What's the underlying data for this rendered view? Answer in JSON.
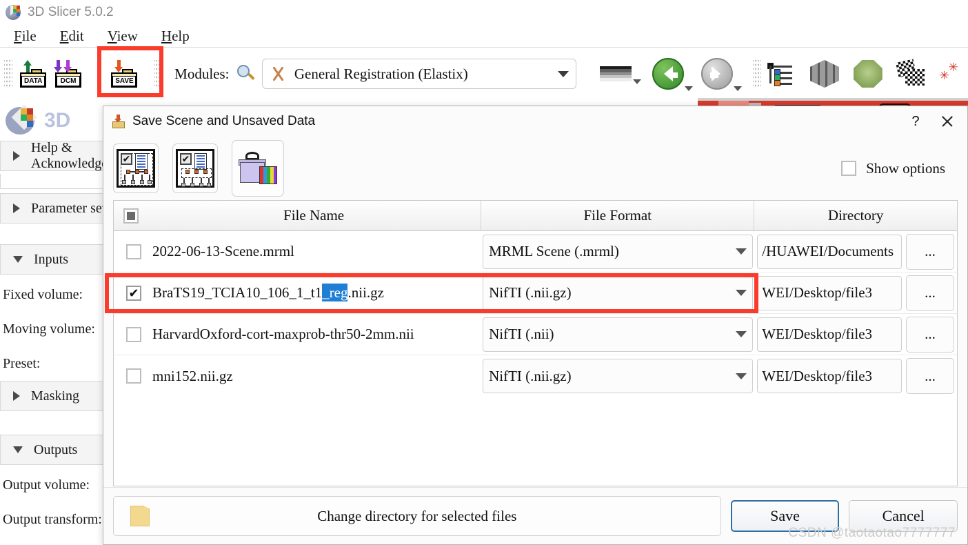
{
  "app": {
    "title": "3D Slicer 5.0.2",
    "logo_icon": "slicer-logo-icon",
    "menus": [
      {
        "label": "File",
        "mnemonic": "F"
      },
      {
        "label": "Edit",
        "mnemonic": "E"
      },
      {
        "label": "View",
        "mnemonic": "V"
      },
      {
        "label": "Help",
        "mnemonic": "H"
      }
    ]
  },
  "toolbar": {
    "data_button_label": "DATA",
    "dcm_button_label": "DCM",
    "save_button_label": "SAVE",
    "modules_label": "Modules:",
    "search_icon": "magnifier-icon",
    "module_selected": "General Registration (Elastix)",
    "module_icon": "elastix-scissors-icon",
    "icons": [
      "grayscale-colormap-icon",
      "previous-module-icon",
      "next-module-icon",
      "subject-hierarchy-icon",
      "volume-rendering-icon",
      "models-icon",
      "grid-transform-icon",
      "markups-icon"
    ],
    "save_button_highlighted": true
  },
  "left_panel": {
    "brand": "3D",
    "logo_icon": "slicer-panel-logo-icon",
    "sections": [
      {
        "label": "Help & Acknowledgement",
        "state": "collapsed"
      },
      {
        "label": "Parameter set",
        "state": "collapsed"
      },
      {
        "label": "Inputs",
        "state": "expanded"
      },
      {
        "label": "Masking",
        "state": "collapsed"
      },
      {
        "label": "Outputs",
        "state": "expanded"
      }
    ],
    "input_fields": [
      "Fixed volume:",
      "Moving volume:",
      "Preset:"
    ],
    "output_fields": [
      "Output volume:",
      "Output transform:"
    ]
  },
  "dialog": {
    "title": "Save Scene and Unsaved Data",
    "title_icon": "save-folder-icon",
    "help_button": "?",
    "close_button": "close-icon",
    "tool_buttons": [
      {
        "name": "select-scene-and-data",
        "icon": "check-scene-tree-icon"
      },
      {
        "name": "select-data-only",
        "icon": "check-data-tree-icon"
      },
      {
        "name": "save-bundle-package",
        "icon": "gift-package-icon"
      }
    ],
    "show_options": {
      "label": "Show options",
      "checked": false
    },
    "table": {
      "headers": [
        "File Name",
        "File Format",
        "Directory"
      ],
      "header_checkbox_state": "partial",
      "browse_button_label": "...",
      "rows": [
        {
          "checked": false,
          "name": "2022-06-13-Scene.mrml",
          "name_prefix": "2022-06-13-Scene.mrml",
          "name_selected": "",
          "name_suffix": "",
          "format": "MRML Scene (.mrml)",
          "directory": "/HUAWEI/Documents",
          "highlighted": false
        },
        {
          "checked": true,
          "name": "BraTS19_TCIA10_106_1_t1_reg.nii.gz",
          "name_prefix": "BraTS19_TCIA10_106_1_t1",
          "name_selected": "_reg",
          "name_suffix": ".nii.gz",
          "format": "NifTI (.nii.gz)",
          "directory": "WEI/Desktop/file3",
          "highlighted": true
        },
        {
          "checked": false,
          "name": "HarvardOxford-cort-maxprob-thr50-2mm.nii",
          "name_prefix": "HarvardOxford-cort-maxprob-thr50-2mm.nii",
          "name_selected": "",
          "name_suffix": "",
          "format": "NifTI (.nii)",
          "directory": "WEI/Desktop/file3",
          "highlighted": false
        },
        {
          "checked": false,
          "name": "mni152.nii.gz",
          "name_prefix": "mni152.nii.gz",
          "name_selected": "",
          "name_suffix": "",
          "format": "NifTI (.nii.gz)",
          "directory": "WEI/Desktop/file3",
          "highlighted": false
        }
      ]
    },
    "change_directory_label": "Change directory for selected files",
    "change_directory_icon": "folder-icon",
    "save_label": "Save",
    "cancel_label": "Cancel"
  },
  "watermark": "CSDN @taotaotao7777777",
  "colors": {
    "highlight_red": "#fa3c2d",
    "selection_blue": "#1e7fd4",
    "primary_button_border": "#2e6ea4",
    "brand_gray": "#8a8a8a"
  }
}
